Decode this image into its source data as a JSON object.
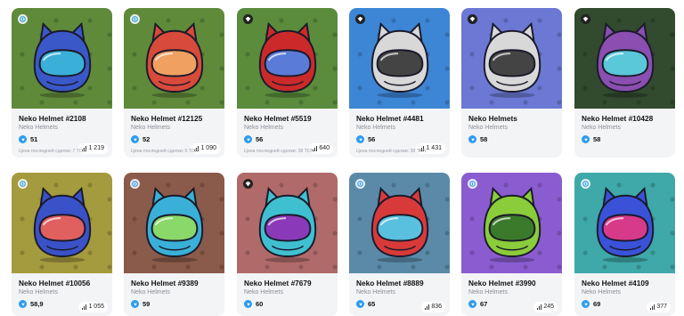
{
  "cards": [
    {
      "title": "Neko Helmet #2108",
      "collection": "Neko Helmets",
      "price": "51",
      "count": "1 219",
      "last_sale": "Цена последней сделки: 7 TON",
      "bg": "#5f8a3a",
      "helmet": "#3a58c8",
      "visor": "#3ab0d8",
      "corner": "blue"
    },
    {
      "title": "Neko Helmet #12125",
      "collection": "Neko Helmets",
      "price": "52",
      "count": "1 090",
      "last_sale": "Цена последней сделки: 5 TON",
      "bg": "#5f8a3a",
      "helmet": "#d84a3a",
      "visor": "#f0a060",
      "corner": "blue"
    },
    {
      "title": "Neko Helmet #5519",
      "collection": "Neko Helmets",
      "price": "56",
      "count": "640",
      "last_sale": "Цена последней сделки: 38 TON",
      "bg": "#5a8c3c",
      "helmet": "#cc2a2a",
      "visor": "#5a7cd8",
      "corner": "dark"
    },
    {
      "title": "Neko Helmet #4481",
      "collection": "Neko Helmets",
      "price": "56",
      "count": "1 431",
      "last_sale": "Цена последней сделки: 38 TON",
      "bg": "#3d86d6",
      "helmet": "#d8d8d8",
      "visor": "#444444",
      "corner": "dark"
    },
    {
      "title": "Neko Helmets",
      "collection": "Neko Helmets",
      "price": "58",
      "count": "",
      "last_sale": "",
      "bg": "#6b78d4",
      "helmet": "#d8d8d8",
      "visor": "#444444",
      "corner": "dark"
    },
    {
      "title": "Neko Helmet #10428",
      "collection": "Neko Helmets",
      "price": "58",
      "count": "",
      "last_sale": "",
      "bg": "#324a2e",
      "helmet": "#8a4fb0",
      "visor": "#5ac8d8",
      "corner": "dark"
    },
    {
      "title": "Neko Helmet #10056",
      "collection": "Neko Helmets",
      "price": "58,9",
      "count": "1 055",
      "last_sale": "",
      "bg": "#a49a3e",
      "helmet": "#3a52c8",
      "visor": "#e06060",
      "corner": "blue"
    },
    {
      "title": "Neko Helmet #9389",
      "collection": "Neko Helmets",
      "price": "59",
      "count": "",
      "last_sale": "",
      "bg": "#8a5a4a",
      "helmet": "#3ab0d8",
      "visor": "#8ad86a",
      "corner": "blue"
    },
    {
      "title": "Neko Helmet #7679",
      "collection": "Neko Helmets",
      "price": "60",
      "count": "",
      "last_sale": "",
      "bg": "#b06a6a",
      "helmet": "#3fc0d0",
      "visor": "#8a3ab8",
      "corner": "dark"
    },
    {
      "title": "Neko Helmet #8889",
      "collection": "Neko Helmets",
      "price": "65",
      "count": "836",
      "last_sale": "",
      "bg": "#5a8aa8",
      "helmet": "#d83a3a",
      "visor": "#5ac0e0",
      "corner": "blue"
    },
    {
      "title": "Neko Helmet #3990",
      "collection": "Neko Helmets",
      "price": "67",
      "count": "245",
      "last_sale": "",
      "bg": "#8a5cd0",
      "helmet": "#8acc3a",
      "visor": "#3a7a2a",
      "corner": "blue"
    },
    {
      "title": "Neko Helmet #4109",
      "collection": "Neko Helmets",
      "price": "69",
      "count": "377",
      "last_sale": "",
      "bg": "#3fa8a8",
      "helmet": "#3a52d8",
      "visor": "#d83a8a",
      "corner": "blue"
    }
  ]
}
